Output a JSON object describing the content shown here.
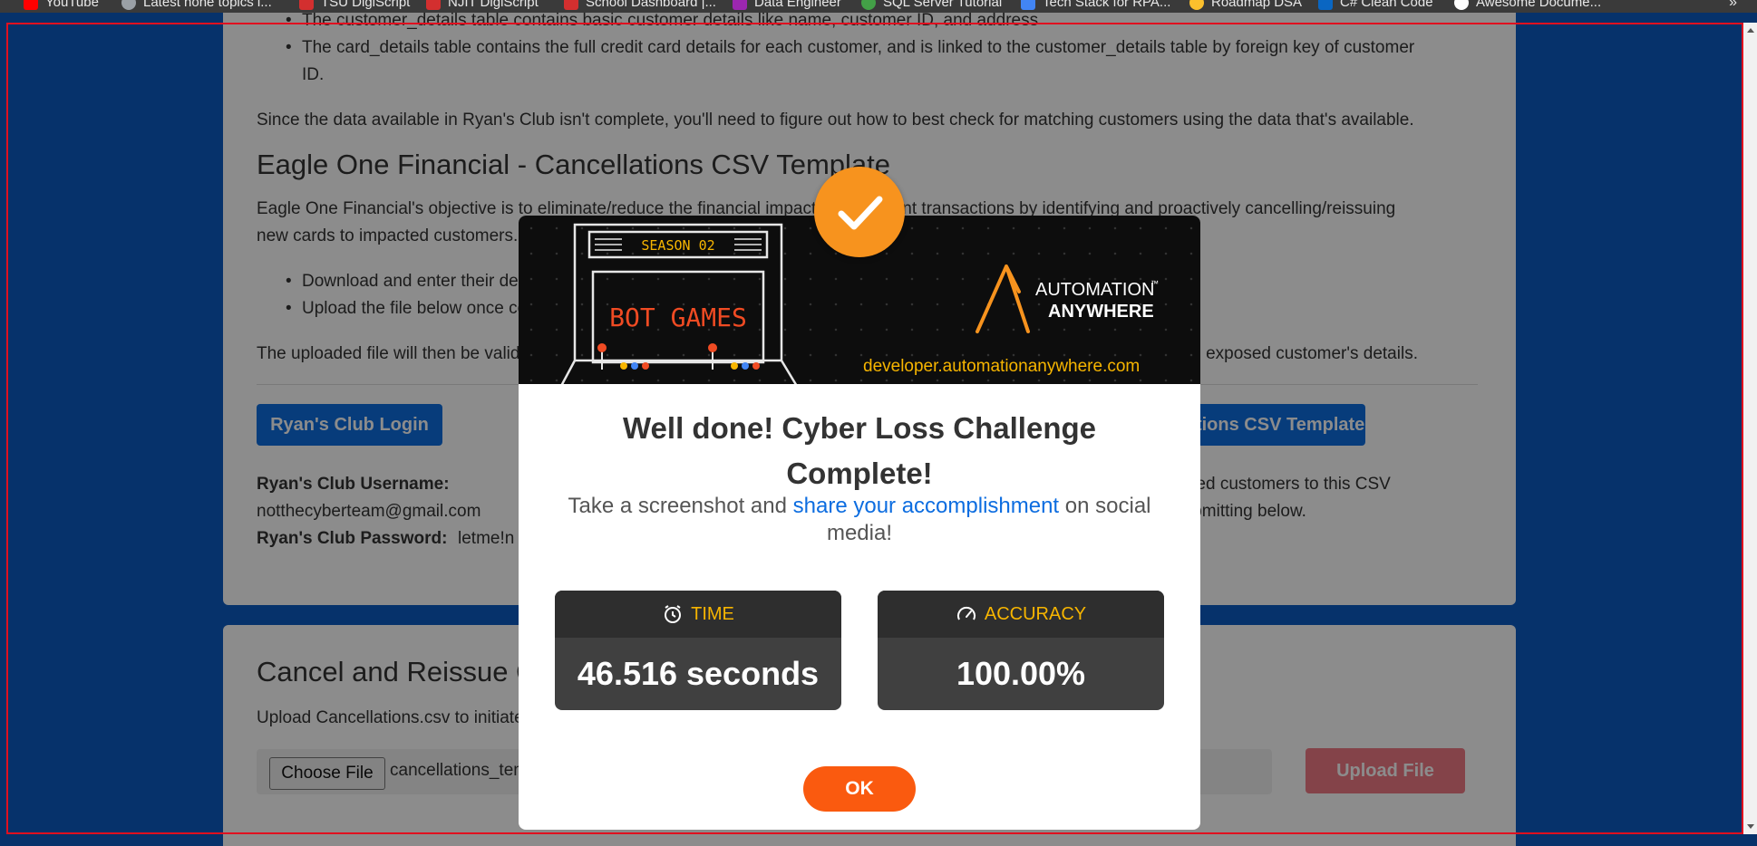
{
  "bookmarks": [
    {
      "label": "YouTube",
      "color": "#ff0000"
    },
    {
      "label": "Latest none topics i...",
      "color": "#9aa0a6"
    },
    {
      "label": "TSU DigiScript",
      "color": "#d32f2f"
    },
    {
      "label": "NJIT DigiScript",
      "color": "#d32f2f"
    },
    {
      "label": "School Dashboard |...",
      "color": "#d32f2f"
    },
    {
      "label": "Data Engineer",
      "color": "#9c27b0"
    },
    {
      "label": "SQL Server Tutorial",
      "color": "#43a047"
    },
    {
      "label": "Tech Stack for RPA...",
      "color": "#4285f4"
    },
    {
      "label": "Roadmap DSA",
      "color": "#fbc02d"
    },
    {
      "label": "C# Clean Code",
      "color": "#0a66c2"
    },
    {
      "label": "Awesome Docume...",
      "color": "#ffffff"
    }
  ],
  "bookmarks_more": "»",
  "content": {
    "bullet_top": "The customer_details table contains basic customer details like name, customer ID, and address",
    "bullet_card_line1": "The card_details table contains the full credit card details for each customer, and is linked to the customer_details table by foreign key of customer",
    "bullet_card_line2": "ID.",
    "para_since": "Since the data available in Ryan's Club isn't complete, you'll need to figure out how to best check for matching customers using the data that's available.",
    "heading_template": "Eagle One Financial - Cancellations CSV Template",
    "para_objective_line1": "Eagle One Financial's objective is to eliminate/reduce the financial impact of fraudulent transactions by identifying and proactively cancelling/reissuing",
    "para_objective_line2": "new cards to impacted customers.",
    "bullet_download": "Download and enter their details into the Cancellations CSV Template.",
    "bullet_upload": "Upload the file below once complete.",
    "para_validated": "The uploaded file will then be validated to confirm accuracy of the cancelled cards and that you've successfully identified the exposed customer's details.",
    "btn_login": "Ryan's Club Login",
    "btn_template": "Cancellations CSV Template",
    "label_username": "Ryan's Club Username:",
    "value_username": "notthecyberteam@gmail.com",
    "label_password": "Ryan's Club Password:",
    "value_password": "letme!n",
    "right_line1": "the matched customers to this CSV",
    "right_line2": "before submitting below.",
    "heading_cancel": "Cancel and Reissue Cards",
    "para_upload": "Upload Cancellations.csv to initiate the cancellation process.",
    "choose_file": "Choose File",
    "file_name": "cancellations_template.csv",
    "btn_upload": "Upload File"
  },
  "modal": {
    "banner_season": "SEASON 02",
    "banner_game": "BOT GAMES",
    "banner_brand_line1": "AUTOMATION",
    "banner_brand_tm": "™",
    "banner_brand_line2": "ANYWHERE",
    "banner_url": "developer.automationanywhere.com",
    "title": "Well done! Cyber Loss Challenge Complete!",
    "sub_before": "Take a screenshot and ",
    "sub_link": "share your accomplishment",
    "sub_after": " on social media!",
    "time_label": "TIME",
    "time_value": "46.516 seconds",
    "accuracy_label": "ACCURACY",
    "accuracy_value": "100.00%",
    "ok_label": "OK",
    "accent_color": "#f7931e"
  }
}
